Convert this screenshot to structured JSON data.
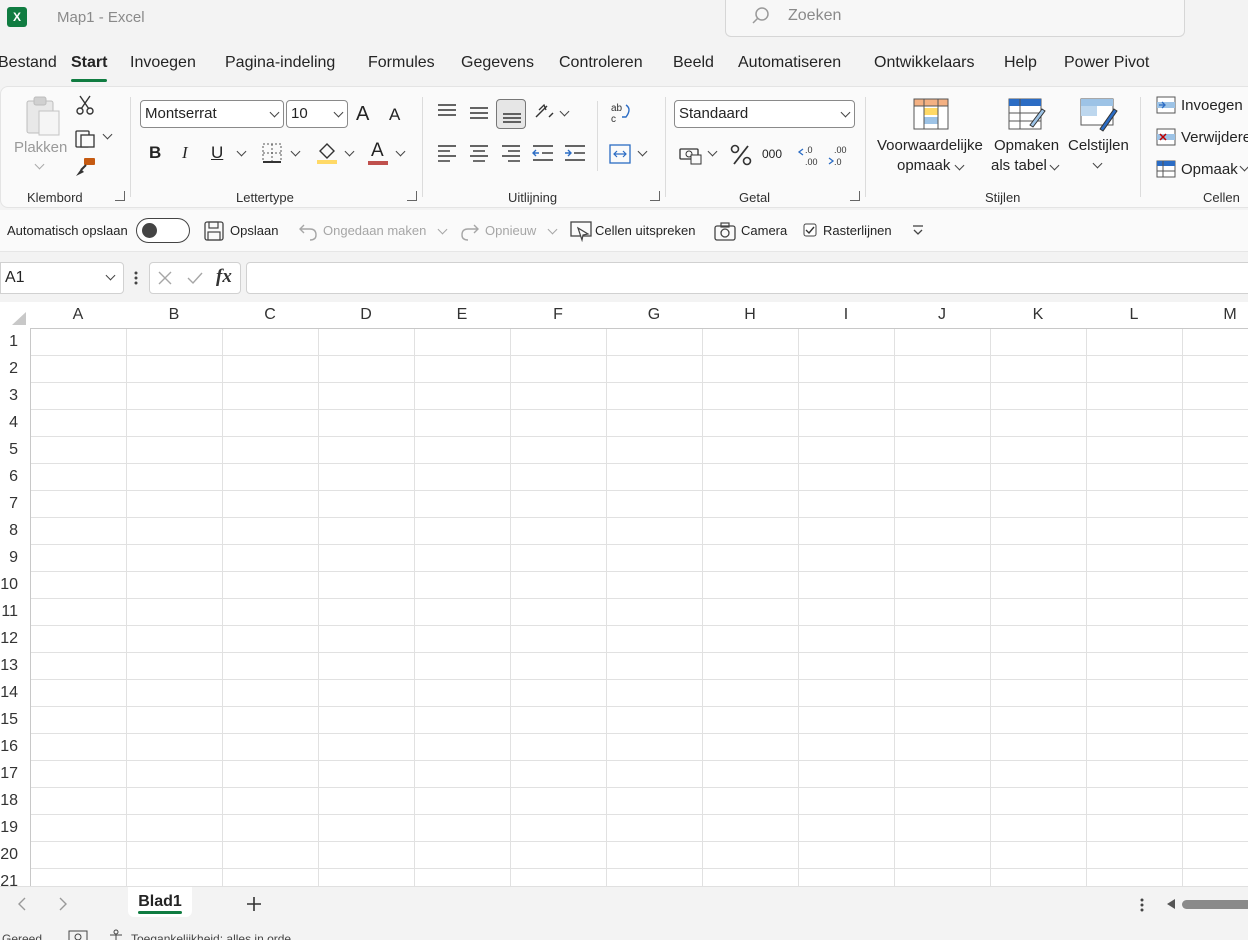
{
  "window": {
    "title": "Map1  -  Excel",
    "logo_letter": "X"
  },
  "search": {
    "placeholder": "Zoeken"
  },
  "tabs": [
    "Bestand",
    "Start",
    "Invoegen",
    "Pagina-indeling",
    "Formules",
    "Gegevens",
    "Controleren",
    "Beeld",
    "Automatiseren",
    "Ontwikkelaars",
    "Help",
    "Power Pivot"
  ],
  "active_tab": "Start",
  "ribbon": {
    "clipboard": {
      "label": "Klembord",
      "paste": "Plakken"
    },
    "font": {
      "label": "Lettertype",
      "name": "Montserrat",
      "size": "10",
      "bold": "B",
      "italic": "I",
      "underline": "U",
      "grow": "A",
      "shrink": "A",
      "color_letter": "A"
    },
    "alignment": {
      "label": "Uitlijning"
    },
    "number": {
      "label": "Getal",
      "format": "Standaard",
      "thousands": "000"
    },
    "styles": {
      "label": "Stijlen",
      "conditional_1": "Voorwaardelijke",
      "conditional_2": "opmaak",
      "table_1": "Opmaken",
      "table_2": "als tabel",
      "cell_styles": "Celstijlen"
    },
    "cells": {
      "label": "Cellen",
      "insert": "Invoegen",
      "delete": "Verwijderen",
      "format": "Opmaak"
    }
  },
  "qat": {
    "autosave": "Automatisch opslaan",
    "save": "Opslaan",
    "undo": "Ongedaan maken",
    "redo": "Opnieuw",
    "speak": "Cellen uitspreken",
    "camera": "Camera",
    "gridlines": "Rasterlijnen"
  },
  "formula_bar": {
    "name_box": "A1",
    "fx": "fx",
    "value": ""
  },
  "grid": {
    "columns": [
      "A",
      "B",
      "C",
      "D",
      "E",
      "F",
      "G",
      "H",
      "I",
      "J",
      "K",
      "L",
      "M"
    ],
    "rows": [
      "1",
      "2",
      "3",
      "4",
      "5",
      "6",
      "7",
      "8",
      "9",
      "10",
      "11",
      "12",
      "13",
      "14",
      "15",
      "16",
      "17",
      "18",
      "19",
      "20",
      "21"
    ]
  },
  "sheets": {
    "active": "Blad1"
  },
  "status": {
    "ready": "Gereed",
    "accessibility": "Toegankelijkheid: alles in orde"
  },
  "colors": {
    "accent": "#107c41",
    "highlight": "#ffd966",
    "font_color": "#c0504d"
  }
}
